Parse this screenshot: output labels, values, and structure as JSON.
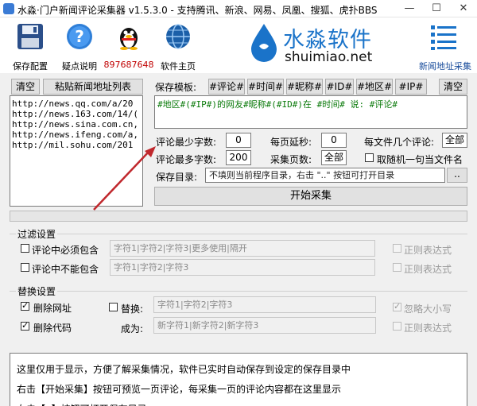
{
  "window": {
    "title": "水淼·门户新闻评论采集器 v1.5.3.0 - 支持腾讯、新浪、网易、凤凰、搜狐、虎扑BBS"
  },
  "toolbar": {
    "save": "保存配置",
    "help": "疑点说明",
    "qq": "897687648",
    "home": "软件主页",
    "brand_cn": "水淼软件",
    "brand_en": "shuimiao.net",
    "news_list": "新闻地址采集"
  },
  "left": {
    "clear": "清空",
    "paste": "粘贴新闻地址列表",
    "urls": [
      "http://news.qq.com/a/20",
      "http://news.163.com/14/(",
      "http://news.sina.com.cn,",
      "http://news.ifeng.com/a,",
      "http://mil.sohu.com/201"
    ]
  },
  "template": {
    "label": "保存模板:",
    "tags": [
      "#评论#",
      "#时间#",
      "#昵称#",
      "#ID#",
      "#地区#",
      "#IP#"
    ],
    "clear": "清空",
    "value": "#地区#(#IP#)的网友#昵称#(#ID#)在 #时间# 说: #评论#"
  },
  "settings": {
    "min_chars_label": "评论最少字数:",
    "min_chars": "0",
    "delay_label": "每页延秒:",
    "delay": "0",
    "per_file_label": "每文件几个评论:",
    "per_file": "全部",
    "max_chars_label": "评论最多字数:",
    "max_chars": "200",
    "pages_label": "采集页数:",
    "pages": "全部",
    "random_name": "取随机一句当文件名",
    "dir_label": "保存目录:",
    "dir_value": "不填则当前程序目录，右击 \"..\" 按钮可打开目录",
    "dir_btn": "..",
    "start": "开始采集"
  },
  "filter": {
    "title": "过滤设置",
    "must_contain": "评论中必须包含",
    "must_hint": "字符1|字符2|字符3|更多使用|隔开",
    "must_not": "评论中不能包含",
    "must_not_hint": "字符1|字符2|字符3",
    "regex": "正则表达式"
  },
  "replace": {
    "title": "替换设置",
    "del_url": "删除网址",
    "del_code": "删除代码",
    "replace_label": "替换:",
    "replace_hint": "字符1|字符2|字符3",
    "to_label": "成为:",
    "to_hint": "新字符1|新字符2|新字符3",
    "ignore_case": "忽略大小写",
    "regex": "正则表达式"
  },
  "log": {
    "lines": [
      "这里仅用于显示，方便了解采集情况，软件已实时自动保存到设定的保存目录中",
      "右击【开始采集】按钮可预览一页评论，每采集一页的评论内容都在这里显示",
      "右击【..】按钮可打开保存目录"
    ]
  },
  "colors": {
    "accent": "#1a73c9",
    "template_text": "#0a7a0a",
    "arrow": "#c0282d"
  }
}
